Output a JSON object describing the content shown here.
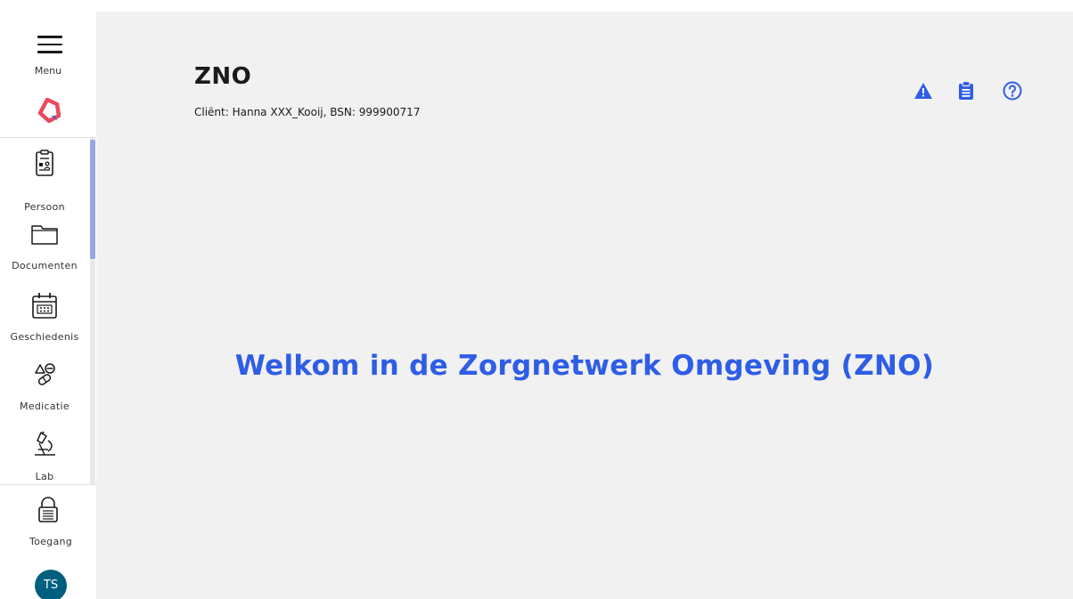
{
  "sidebar": {
    "menu_label": "Menu",
    "items": [
      {
        "label": "Persoon",
        "icon": "person-card-icon"
      },
      {
        "label": "Documenten",
        "icon": "folder-icon"
      },
      {
        "label": "Geschiedenis",
        "icon": "calendar-icon"
      },
      {
        "label": "Medicatie",
        "icon": "medication-icon"
      },
      {
        "label": "Lab",
        "icon": "microscope-icon"
      }
    ],
    "access_label": "Toegang",
    "avatar_initials": "TS"
  },
  "header": {
    "title": "ZNO",
    "client_info": "Cliënt: Hanna XXX_Kooij, BSN: 999900717",
    "icons": [
      "warning-icon",
      "clipboard-icon",
      "help-icon"
    ]
  },
  "main": {
    "welcome": "Welkom in de Zorgnetwerk Omgeving (ZNO)"
  },
  "colors": {
    "accent": "#2e5de6",
    "logo": "#e84a5f",
    "avatar": "#005f7f",
    "scroll_thumb": "#97a5e9"
  }
}
